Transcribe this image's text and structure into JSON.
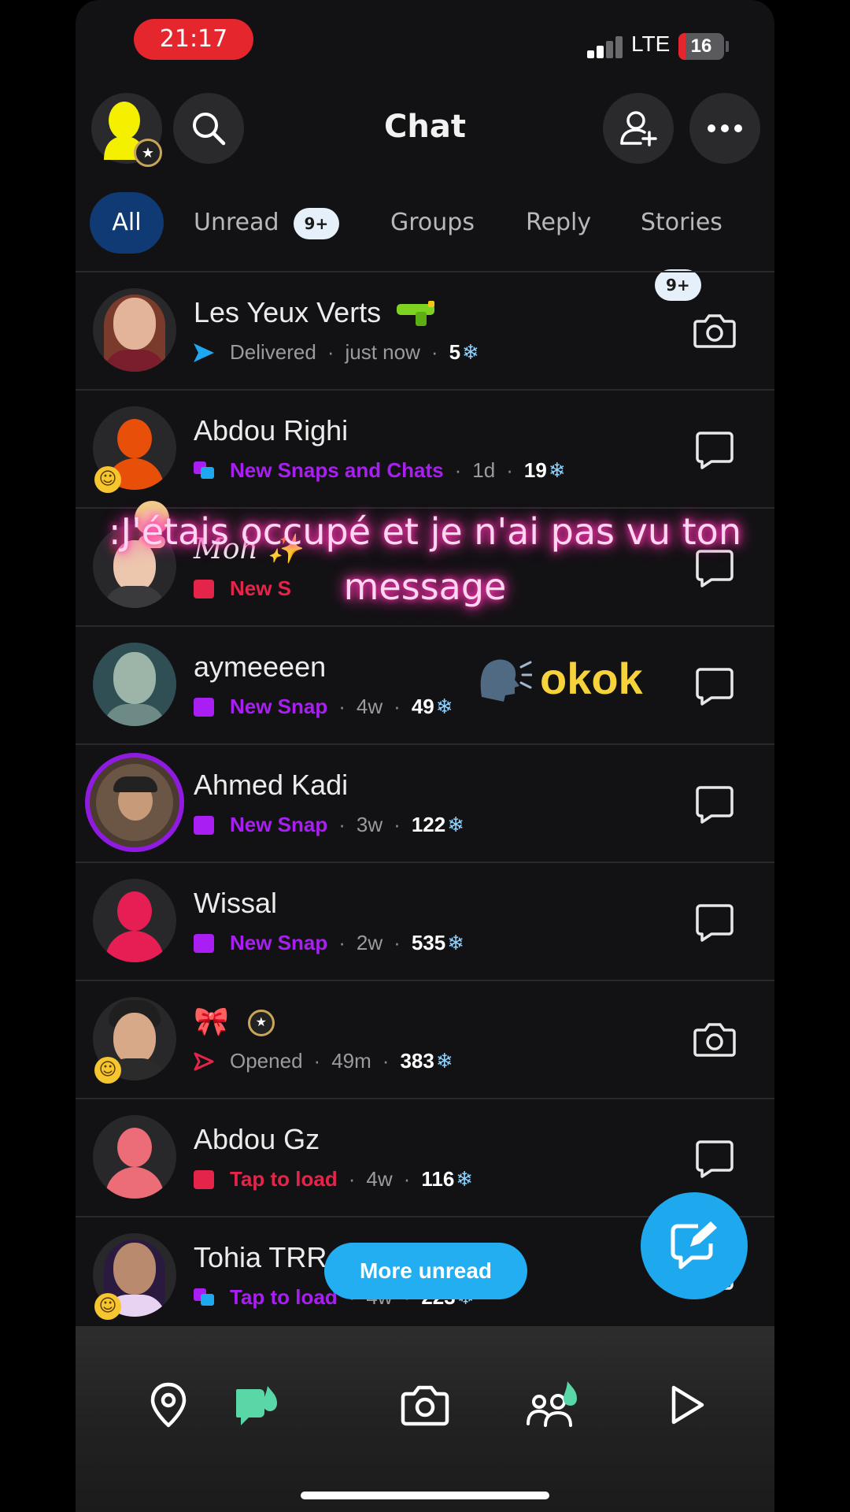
{
  "status_bar": {
    "time": "21:17",
    "network": "LTE",
    "battery": "16",
    "battery_level": 0.16
  },
  "header": {
    "title": "Chat"
  },
  "tabs": [
    {
      "label": "All",
      "active": true
    },
    {
      "label": "Unread",
      "badge": "9+"
    },
    {
      "label": "Groups"
    },
    {
      "label": "Reply"
    },
    {
      "label": "Stories",
      "badge": "9+"
    }
  ],
  "chats": [
    {
      "name": "Les Yeux Verts",
      "name_icon": "water-gun-icon",
      "status_icon": "sent-arrow-blue-icon",
      "status_text": "Delivered",
      "status_style": "gray",
      "time": "just now",
      "streak": "5",
      "action_icon": "camera-icon"
    },
    {
      "name": "Abdou Righi",
      "status_icon": "snaps-and-chats-icon",
      "status_text": "New Snaps and Chats",
      "status_style": "purple",
      "time": "1d",
      "streak": "19",
      "action_icon": "chat-bubble-icon"
    },
    {
      "name": "Moh",
      "name_icon": "sparkles-icon",
      "status_icon": "red-square-icon",
      "status_text": "New S",
      "status_style": "red",
      "action_icon": "chat-bubble-icon"
    },
    {
      "name": "aymeeeen",
      "status_icon": "purple-square-icon",
      "status_text": "New Snap",
      "status_style": "purple",
      "time": "4w",
      "streak": "49",
      "action_icon": "chat-bubble-icon"
    },
    {
      "name": "Ahmed Kadi",
      "status_icon": "purple-square-icon",
      "status_text": "New Snap",
      "status_style": "purple",
      "time": "3w",
      "streak": "122",
      "action_icon": "chat-bubble-icon"
    },
    {
      "name": "Wissal",
      "status_icon": "purple-square-icon",
      "status_text": "New Snap",
      "status_style": "purple",
      "time": "2w",
      "streak": "535",
      "action_icon": "chat-bubble-icon"
    },
    {
      "name": "🎀",
      "name_icon": "star-badge-icon",
      "status_icon": "opened-arrow-red-icon",
      "status_text": "Opened",
      "status_style": "gray",
      "time": "49m",
      "streak": "383",
      "action_icon": "camera-icon"
    },
    {
      "name": "Abdou Gz",
      "status_icon": "red-square-icon",
      "status_text": "Tap to load",
      "status_style": "red",
      "time": "4w",
      "streak": "116",
      "action_icon": "chat-bubble-icon"
    },
    {
      "name": "Tohia TRR",
      "status_icon": "snaps-and-chats-icon",
      "status_text": "Tap to load",
      "status_style": "purple",
      "time": "4w",
      "streak": "223",
      "action_icon": "chat-bubble-icon"
    }
  ],
  "overlays": {
    "caption": ":J'étais occupé et je n'ai pas vu ton message",
    "reply": "okok"
  },
  "more_unread_label": "More unread",
  "bottom_nav": [
    "map-icon",
    "chat-icon",
    "camera-icon",
    "friends-icon",
    "stories-play-icon"
  ],
  "colors": {
    "accent_blue": "#1ea9ef",
    "purple": "#a91ef2",
    "red": "#e5244a",
    "active_tab": "#0f3a73"
  }
}
